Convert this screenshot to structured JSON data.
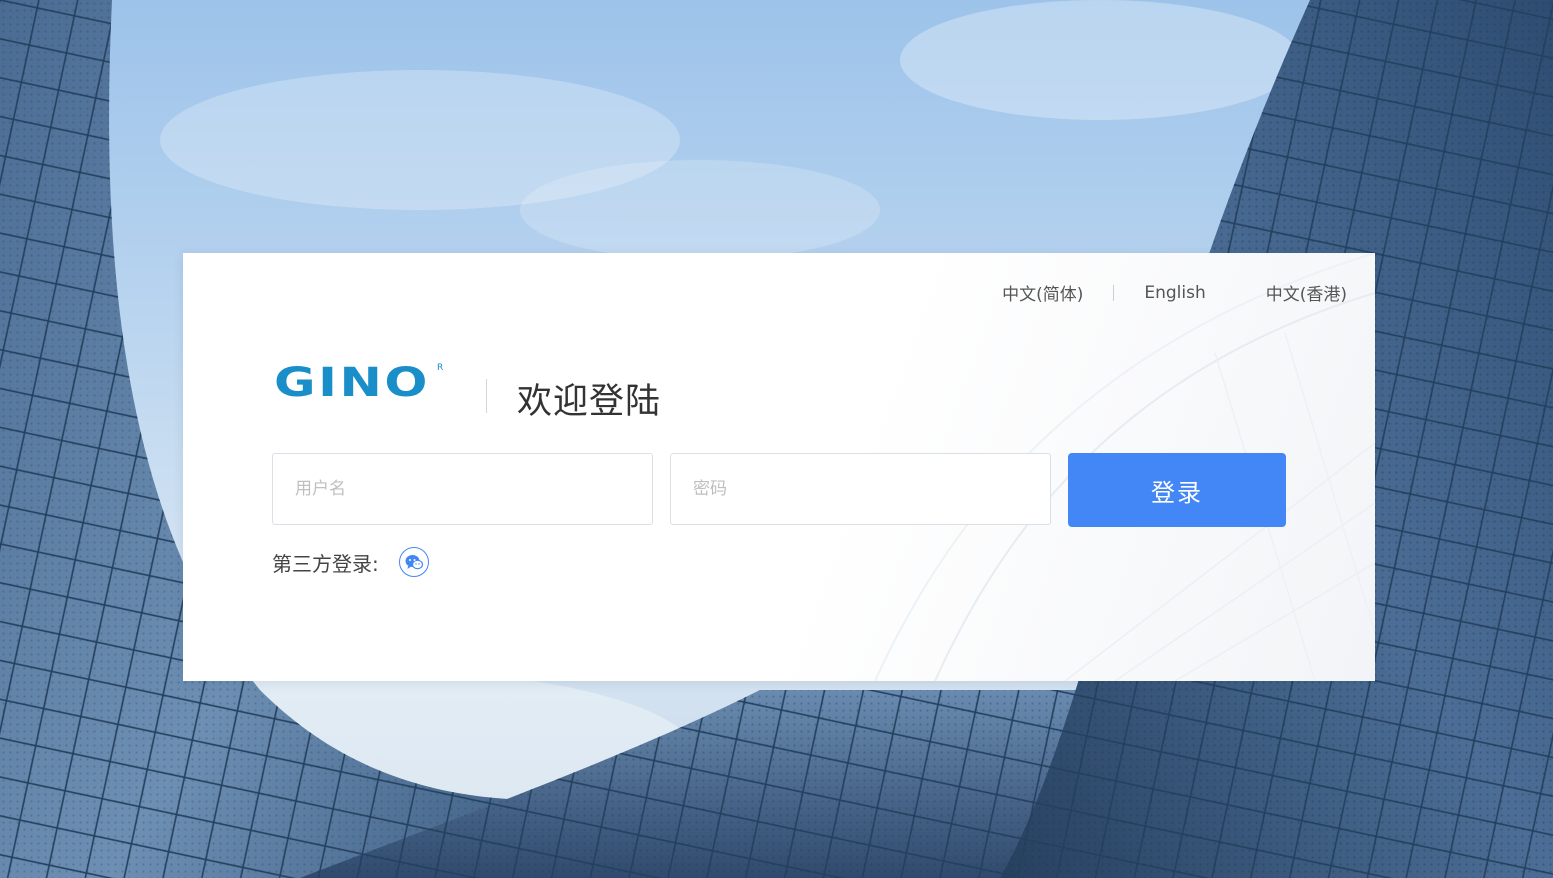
{
  "languages": {
    "simplified": "中文(简体)",
    "english": "English",
    "hongkong": "中文(香港)"
  },
  "brand": {
    "logo_text": "GINO",
    "registered_mark": "R"
  },
  "login": {
    "title": "欢迎登陆",
    "username_placeholder": "用户名",
    "password_placeholder": "密码",
    "submit_label": "登录",
    "third_party_label": "第三方登录:",
    "third_party_icon": "wechat-icon"
  },
  "colors": {
    "accent": "#4287f5",
    "logo": "#1a8ec8"
  }
}
